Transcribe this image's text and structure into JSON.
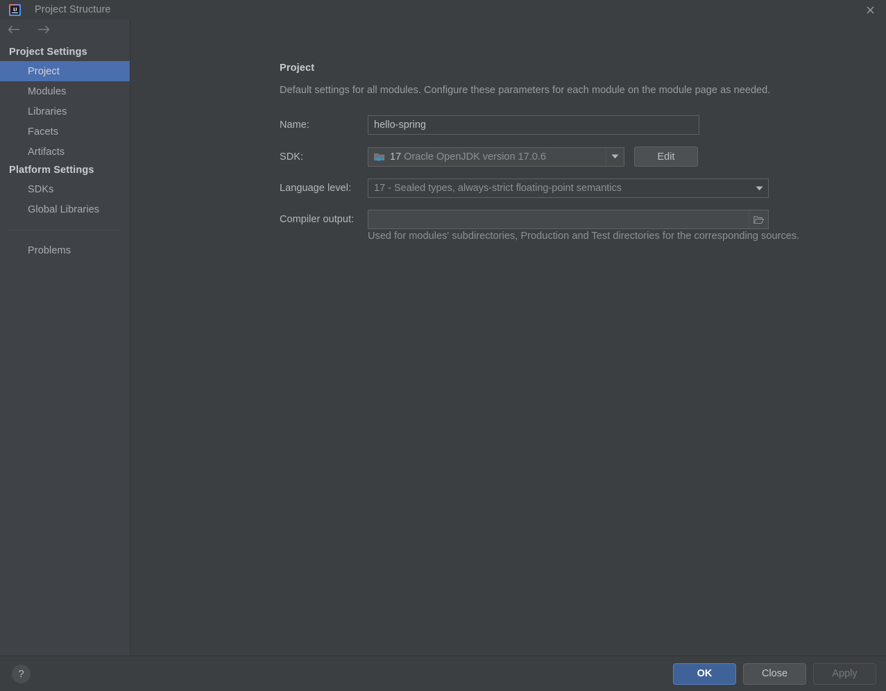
{
  "window": {
    "title": "Project Structure",
    "app_icon": "intellij-idea-icon",
    "close_icon": "close-icon"
  },
  "navigation": {
    "back_icon": "arrow-left-icon",
    "forward_icon": "arrow-right-icon"
  },
  "sidebar": {
    "groups": [
      {
        "label": "Project Settings",
        "items": [
          {
            "label": "Project",
            "selected": true
          },
          {
            "label": "Modules",
            "selected": false
          },
          {
            "label": "Libraries",
            "selected": false
          },
          {
            "label": "Facets",
            "selected": false
          },
          {
            "label": "Artifacts",
            "selected": false
          }
        ]
      },
      {
        "label": "Platform Settings",
        "items": [
          {
            "label": "SDKs",
            "selected": false
          },
          {
            "label": "Global Libraries",
            "selected": false
          }
        ]
      }
    ],
    "extra_items": [
      {
        "label": "Problems",
        "selected": false
      }
    ]
  },
  "main": {
    "section_title": "Project",
    "section_description": "Default settings for all modules. Configure these parameters for each module on the module page as needed.",
    "fields": {
      "name": {
        "label": "Name:",
        "value": "hello-spring",
        "placeholder": ""
      },
      "sdk": {
        "label": "SDK:",
        "version": "17",
        "description": "Oracle OpenJDK version 17.0.6",
        "icon": "java-sdk-folder-icon",
        "dropdown_icon": "chevron-down-icon",
        "edit_button": "Edit"
      },
      "language_level": {
        "label": "Language level:",
        "value": "17 - Sealed types, always-strict floating-point semantics",
        "dropdown_icon": "chevron-down-icon"
      },
      "compiler_output": {
        "label": "Compiler output:",
        "value": "",
        "placeholder": "",
        "browse_icon": "folder-open-icon",
        "hint": "Used for modules' subdirectories, Production and Test directories for the corresponding sources."
      }
    }
  },
  "footer": {
    "help_label": "?",
    "ok_label": "OK",
    "close_label": "Close",
    "apply_label": "Apply"
  },
  "colors": {
    "background": "#3c3f41",
    "sidebar_background": "#3f4347",
    "selection_blue": "#4b6eaf",
    "primary_button": "#3f6398",
    "text": "#b4b7bb",
    "text_dim": "#8e9194"
  }
}
